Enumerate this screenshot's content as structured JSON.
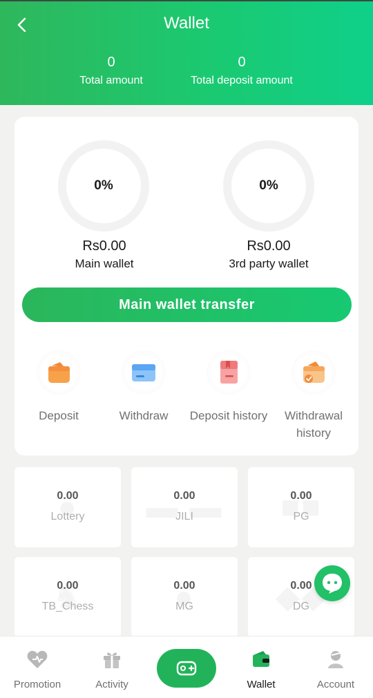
{
  "header": {
    "title": "Wallet",
    "stats": [
      {
        "value": "0",
        "label": "Total amount"
      },
      {
        "value": "0",
        "label": "Total deposit amount"
      }
    ]
  },
  "wallets": {
    "main": {
      "percent": "0%",
      "amount": "Rs0.00",
      "label": "Main wallet"
    },
    "third": {
      "percent": "0%",
      "amount": "Rs0.00",
      "label": "3rd party wallet"
    }
  },
  "transfer_button": "Main wallet transfer",
  "actions": [
    {
      "label": "Deposit",
      "icon": "wallet-icon"
    },
    {
      "label": "Withdraw",
      "icon": "card-icon"
    },
    {
      "label": "Deposit history",
      "icon": "receipt-icon"
    },
    {
      "label": "Withdrawal history",
      "icon": "wallet-check-icon"
    }
  ],
  "games": [
    {
      "value": "0.00",
      "name": "Lottery"
    },
    {
      "value": "0.00",
      "name": "JILI"
    },
    {
      "value": "0.00",
      "name": "PG"
    },
    {
      "value": "0.00",
      "name": "TB_Chess"
    },
    {
      "value": "0.00",
      "name": "MG"
    },
    {
      "value": "0.00",
      "name": "DG"
    }
  ],
  "tabs": [
    {
      "label": "Promotion",
      "icon": "heart-icon"
    },
    {
      "label": "Activity",
      "icon": "gift-icon"
    },
    {
      "label": "",
      "icon": "gamepad-icon"
    },
    {
      "label": "Wallet",
      "icon": "wallet-icon",
      "active": true
    },
    {
      "label": "Account",
      "icon": "user-icon"
    }
  ],
  "colors": {
    "primary": "#22b35a",
    "header_gradient_start": "#2fb75c",
    "header_gradient_end": "#0fd08a",
    "deposit_orange": "#f7a24a",
    "withdraw_blue": "#5aa6f2",
    "history_red": "#f07a7a"
  }
}
